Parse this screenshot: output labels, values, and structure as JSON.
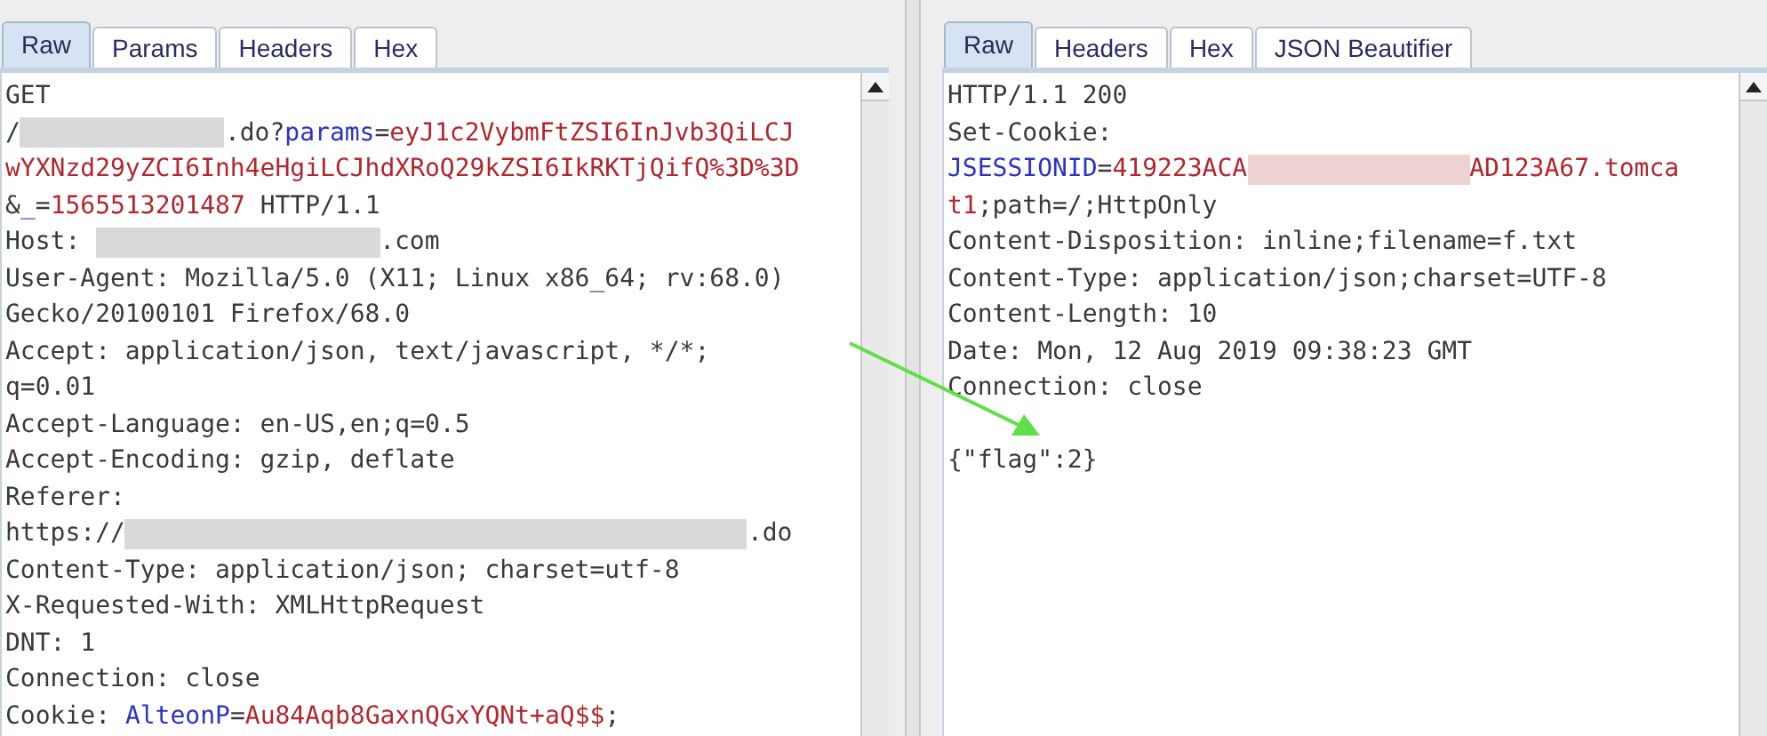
{
  "request": {
    "tabs": [
      {
        "label": "Raw",
        "selected": true
      },
      {
        "label": "Params",
        "selected": false
      },
      {
        "label": "Headers",
        "selected": false
      },
      {
        "label": "Hex",
        "selected": false
      }
    ],
    "lines": [
      [
        {
          "kind": "text",
          "text": "GET"
        }
      ],
      [
        {
          "kind": "text",
          "text": "/"
        },
        {
          "kind": "redacted"
        },
        {
          "kind": "text",
          "text": ".do?"
        },
        {
          "kind": "key",
          "text": "params"
        },
        {
          "kind": "text",
          "text": "="
        },
        {
          "kind": "value",
          "text": "eyJ1c2VybmFtZSI6InJvb3QiLCJ"
        }
      ],
      [
        {
          "kind": "value",
          "text": "wYXNzd29yZCI6Inh4eHgiLCJhdXRoQ29kZSI6IkRKTjQifQ%3D%3D"
        }
      ],
      [
        {
          "kind": "text",
          "text": "&"
        },
        {
          "kind": "key",
          "text": "_"
        },
        {
          "kind": "text",
          "text": "="
        },
        {
          "kind": "value",
          "text": "1565513201487"
        },
        {
          "kind": "text",
          "text": " HTTP/1.1"
        }
      ],
      [
        {
          "kind": "text",
          "text": "Host: "
        },
        {
          "kind": "redacted"
        },
        {
          "kind": "text",
          "text": ".com"
        }
      ],
      [
        {
          "kind": "text",
          "text": "User-Agent: Mozilla/5.0 (X11; Linux x86_64; rv:68.0)"
        }
      ],
      [
        {
          "kind": "text",
          "text": "Gecko/20100101 Firefox/68.0"
        }
      ],
      [
        {
          "kind": "text",
          "text": "Accept: application/json, text/javascript, */*;"
        }
      ],
      [
        {
          "kind": "text",
          "text": "q=0.01"
        }
      ],
      [
        {
          "kind": "text",
          "text": "Accept-Language: en-US,en;q=0.5"
        }
      ],
      [
        {
          "kind": "text",
          "text": "Accept-Encoding: gzip, deflate"
        }
      ],
      [
        {
          "kind": "text",
          "text": "Referer:"
        }
      ],
      [
        {
          "kind": "text",
          "text": "https://"
        },
        {
          "kind": "redacted"
        },
        {
          "kind": "text",
          "text": ".do"
        }
      ],
      [
        {
          "kind": "text",
          "text": "Content-Type: application/json; charset=utf-8"
        }
      ],
      [
        {
          "kind": "text",
          "text": "X-Requested-With: XMLHttpRequest"
        }
      ],
      [
        {
          "kind": "text",
          "text": "DNT: 1"
        }
      ],
      [
        {
          "kind": "text",
          "text": "Connection: close"
        }
      ],
      [
        {
          "kind": "text",
          "text": "Cookie: "
        },
        {
          "kind": "key",
          "text": "AlteonP"
        },
        {
          "kind": "text",
          "text": "="
        },
        {
          "kind": "value",
          "text": "Au84Aqb8GaxnQGxYQNt+aQ$$"
        },
        {
          "kind": "text",
          "text": ";"
        }
      ]
    ]
  },
  "response": {
    "tabs": [
      {
        "label": "Raw",
        "selected": true
      },
      {
        "label": "Headers",
        "selected": false
      },
      {
        "label": "Hex",
        "selected": false
      },
      {
        "label": "JSON Beautifier",
        "selected": false
      }
    ],
    "lines": [
      [
        {
          "kind": "text",
          "text": "HTTP/1.1 200"
        }
      ],
      [
        {
          "kind": "text",
          "text": "Set-Cookie:"
        }
      ],
      [
        {
          "kind": "key",
          "text": "JSESSIONID"
        },
        {
          "kind": "text",
          "text": "="
        },
        {
          "kind": "value",
          "text": "419223ACA"
        },
        {
          "kind": "redacted"
        },
        {
          "kind": "value",
          "text": "AD123A67.tomca"
        }
      ],
      [
        {
          "kind": "value",
          "text": "t1"
        },
        {
          "kind": "text",
          "text": ";path=/;HttpOnly"
        }
      ],
      [
        {
          "kind": "text",
          "text": "Content-Disposition: inline;filename=f.txt"
        }
      ],
      [
        {
          "kind": "text",
          "text": "Content-Type: application/json;charset=UTF-8"
        }
      ],
      [
        {
          "kind": "text",
          "text": "Content-Length: 10"
        }
      ],
      [
        {
          "kind": "text",
          "text": "Date: Mon, 12 Aug 2019 09:38:23 GMT"
        }
      ],
      [
        {
          "kind": "text",
          "text": "Connection: close"
        }
      ],
      [
        {
          "kind": "blank"
        }
      ],
      [
        {
          "kind": "text",
          "text": "{\"flag\":2}"
        }
      ]
    ]
  }
}
